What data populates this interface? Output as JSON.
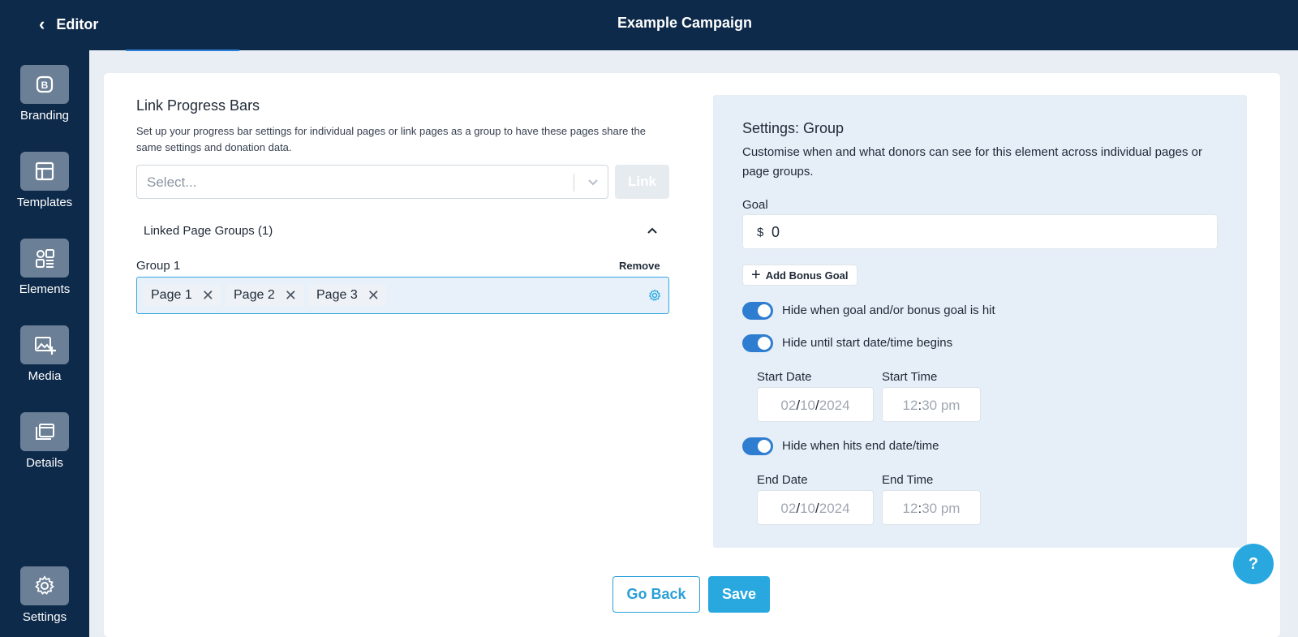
{
  "header": {
    "back_label": "Editor",
    "title": "Example Campaign"
  },
  "sidebar": {
    "items": [
      {
        "label": "Branding",
        "icon": "branding-icon"
      },
      {
        "label": "Templates",
        "icon": "templates-icon"
      },
      {
        "label": "Elements",
        "icon": "elements-icon"
      },
      {
        "label": "Media",
        "icon": "media-icon"
      },
      {
        "label": "Details",
        "icon": "details-icon"
      },
      {
        "label": "Settings",
        "icon": "gear-icon"
      }
    ]
  },
  "link": {
    "title": "Link Progress Bars",
    "description": "Set up your progress bar settings for individual pages or link pages as a group to have these pages share the same settings and donation data.",
    "select_placeholder": "Select...",
    "link_button": "Link",
    "linked_groups_label": "Linked Page Groups (1)",
    "group": {
      "label": "Group 1",
      "remove_label": "Remove",
      "pages": [
        "Page 1",
        "Page 2",
        "Page 3"
      ]
    }
  },
  "settings": {
    "title": "Settings: Group",
    "description": "Customise when and what donors can see for this element across individual pages or page groups.",
    "goal_label": "Goal",
    "goal_currency": "$",
    "goal_value": "0",
    "bonus_button": "Add Bonus Goal",
    "toggles": [
      {
        "label": "Hide when goal and/or bonus goal is hit",
        "on": true
      },
      {
        "label": "Hide until start date/time begins",
        "on": true
      },
      {
        "label": "Hide when hits end date/time",
        "on": true
      }
    ],
    "start": {
      "date_label": "Start Date",
      "time_label": "Start Time",
      "day": "02",
      "month": "10",
      "year": "2024",
      "hour": "12",
      "minute": "30",
      "ampm": "pm"
    },
    "end": {
      "date_label": "End Date",
      "time_label": "End Time",
      "day": "02",
      "month": "10",
      "year": "2024",
      "hour": "12",
      "minute": "30",
      "ampm": "pm"
    }
  },
  "footer": {
    "back_button": "Go Back",
    "save_button": "Save"
  },
  "help_label": "?",
  "colors": {
    "navy": "#0e2a4a",
    "accent": "#29a8e0",
    "toggle": "#2e7dd0"
  }
}
